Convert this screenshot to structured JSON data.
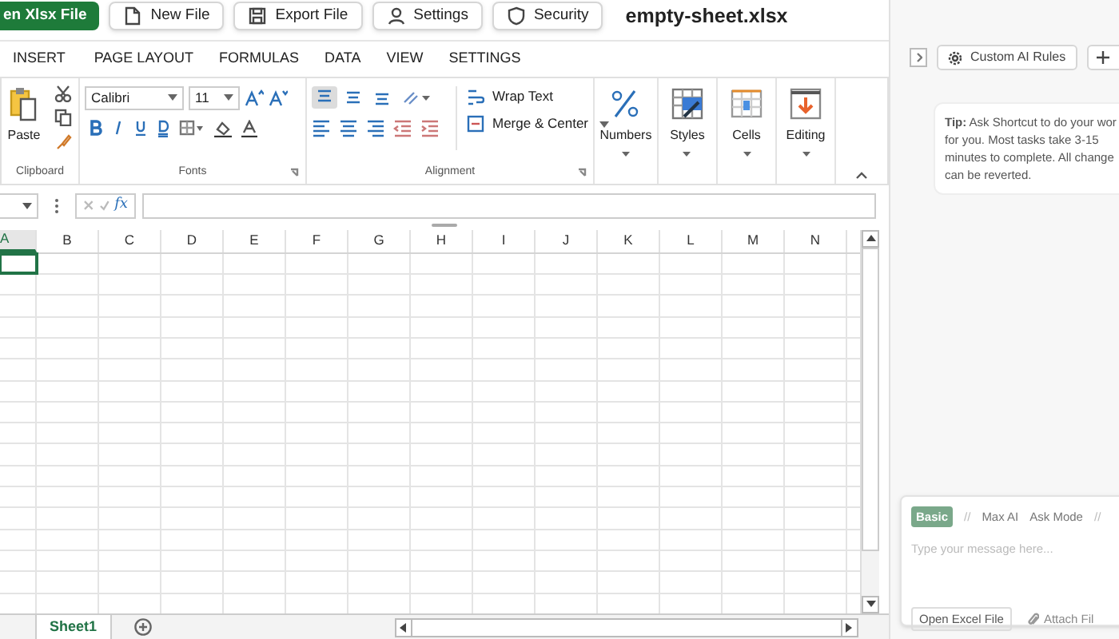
{
  "top_bar": {
    "buttons": [
      {
        "label": "en Xlsx File",
        "kind": "primary"
      },
      {
        "label": "New File",
        "kind": "file"
      },
      {
        "label": "Export File",
        "kind": "save"
      },
      {
        "label": "Settings",
        "kind": "user"
      },
      {
        "label": "Security",
        "kind": "shield"
      }
    ],
    "file_name": "empty-sheet.xlsx"
  },
  "ribbon": {
    "tabs": [
      "INSERT",
      "PAGE LAYOUT",
      "FORMULAS",
      "DATA",
      "VIEW",
      "SETTINGS"
    ],
    "clipboard": {
      "paste": "Paste",
      "label": "Clipboard"
    },
    "fonts": {
      "font_name": "Calibri",
      "font_size": "11",
      "label": "Fonts"
    },
    "alignment": {
      "label": "Alignment",
      "wrap_text": "Wrap Text",
      "merge": "Merge & Center",
      "vertical_buttons": [
        {
          "kind": "top",
          "selected": true
        },
        {
          "kind": "middle",
          "selected": false
        },
        {
          "kind": "bottom",
          "selected": false
        }
      ]
    },
    "commands": [
      {
        "label": "Numbers",
        "kind": "percent"
      },
      {
        "label": "Styles",
        "kind": "styles"
      },
      {
        "label": "Cells",
        "kind": "cells"
      },
      {
        "label": "Editing",
        "kind": "editing"
      }
    ]
  },
  "formula_bar": {
    "function_symbol": "fx"
  },
  "sheet": {
    "columns": [
      {
        "label": "A",
        "selected": true
      },
      {
        "label": "B",
        "selected": false
      },
      {
        "label": "C",
        "selected": false
      },
      {
        "label": "D",
        "selected": false
      },
      {
        "label": "E",
        "selected": false
      },
      {
        "label": "F",
        "selected": false
      },
      {
        "label": "G",
        "selected": false
      },
      {
        "label": "H",
        "selected": false
      },
      {
        "label": "I",
        "selected": false
      },
      {
        "label": "J",
        "selected": false
      },
      {
        "label": "K",
        "selected": false
      },
      {
        "label": "L",
        "selected": false
      },
      {
        "label": "M",
        "selected": false
      },
      {
        "label": "N",
        "selected": false
      }
    ],
    "tabs": [
      {
        "label": "Sheet1",
        "selected": true
      }
    ]
  },
  "side_panel": {
    "rules_button": "Custom AI Rules",
    "tip_lines": [
      "**Tip:** Ask Shortcut to do your wor",
      "for you. Most tasks take 3-15",
      "minutes to complete. All change",
      "can be reverted."
    ],
    "chat": {
      "mode_bar": [
        {
          "kind": "mode",
          "label": "Basic",
          "selected": true
        },
        {
          "kind": "separator",
          "label": "//"
        },
        {
          "kind": "mode",
          "label": "Max AI",
          "selected": false
        },
        {
          "kind": "mode",
          "label": "Ask Mode",
          "selected": false
        },
        {
          "kind": "separator",
          "label": "//"
        }
      ],
      "placeholder": "Type your message here...",
      "buttons": [
        "Open Excel File",
        "Attach Fil"
      ]
    }
  }
}
